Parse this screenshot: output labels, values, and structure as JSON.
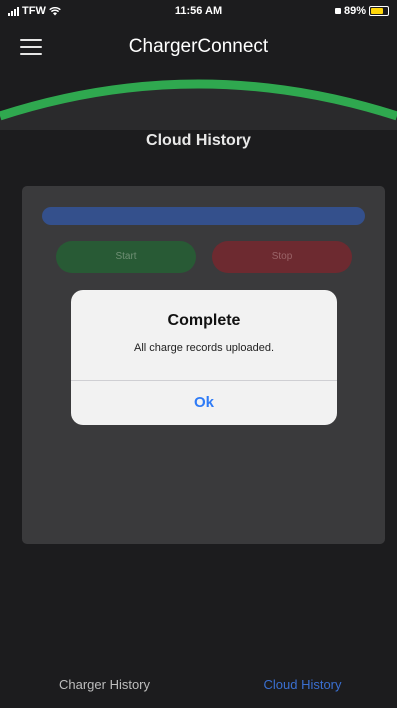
{
  "status_bar": {
    "carrier": "TFW",
    "time": "11:56 AM",
    "battery": "89%",
    "battery_level": 0.89,
    "battery_color": "#ffd60a",
    "icons": [
      "signal-icon",
      "wifi-icon",
      "lock-icon",
      "battery-icon"
    ]
  },
  "header": {
    "title": "ChargerConnect",
    "menu_icon": "hamburger-menu-icon",
    "arc_color": "#2fa84f"
  },
  "screen": {
    "title": "Cloud History"
  },
  "controls": {
    "progress_color": "#34508c",
    "start_label": "Start",
    "start_color": "#285a35",
    "stop_label": "Stop",
    "stop_color": "#6d2a30"
  },
  "alert": {
    "title": "Complete",
    "message": "All charge records uploaded.",
    "ok_label": "Ok",
    "ok_color": "#2f7bf6"
  },
  "tabs": [
    {
      "label": "Charger History",
      "active": false
    },
    {
      "label": "Cloud History",
      "active": true,
      "color": "#3a6fd0"
    }
  ]
}
